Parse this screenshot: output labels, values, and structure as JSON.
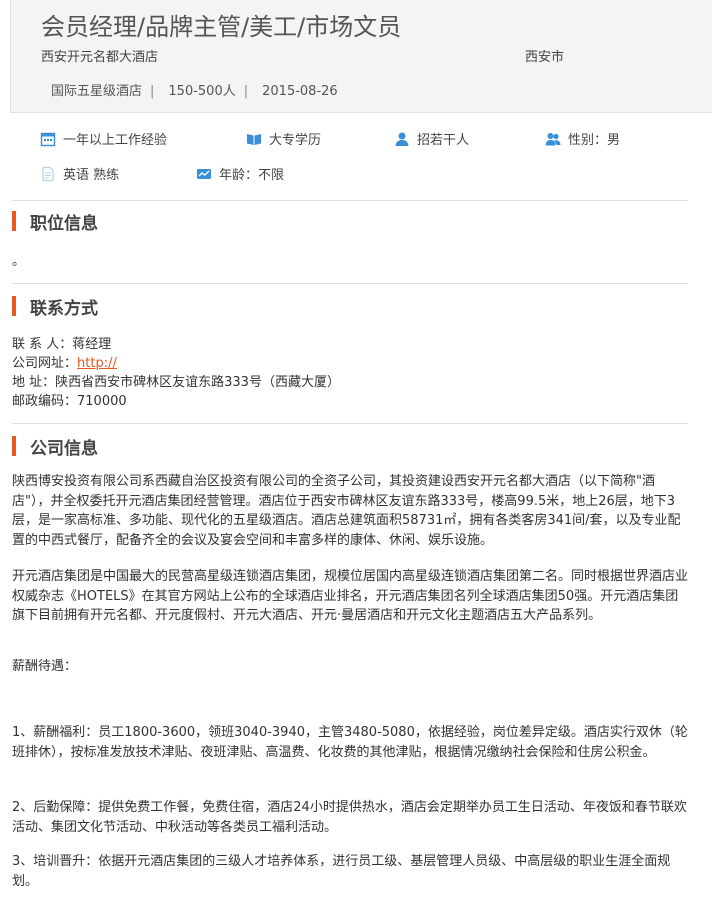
{
  "job": {
    "title": "会员经理/品牌主管/美工/市场文员",
    "company": "西安开元名都大酒店",
    "city": "西安市",
    "meta": [
      "国际五星级酒店",
      "150-500人",
      "2015-08-26"
    ],
    "meta_sep": "|"
  },
  "requirements": [
    {
      "icon": "calendar-icon",
      "label": "一年以上工作经验"
    },
    {
      "icon": "book-icon",
      "label": "大专学历"
    },
    {
      "icon": "person-icon",
      "label": "招若干人"
    },
    {
      "icon": "group-icon",
      "label": "性别：男"
    },
    {
      "icon": "document-icon",
      "label": "英语 熟练"
    },
    {
      "icon": "chart-icon",
      "label": "年龄：不限"
    }
  ],
  "sections": {
    "position": {
      "title": "职位信息",
      "body": "。"
    },
    "contact": {
      "title": "联系方式",
      "contact_person": "联 系 人：蒋经理",
      "website_label": "公司网址：",
      "website_link": "http://",
      "address": "地 址：陕西省西安市碑林区友谊东路333号（西藏大厦）",
      "postcode": "邮政编码：710000"
    },
    "company": {
      "title": "公司信息",
      "paragraphs": [
        "陕西博安投资有限公司系西藏自治区投资有限公司的全资子公司，其投资建设西安开元名都大酒店（以下简称\"酒店\"），并全权委托开元酒店集团经营管理。酒店位于西安市碑林区友谊东路333号，楼高99.5米，地上26层，地下3层，是一家高标准、多功能、现代化的五星级酒店。酒店总建筑面积58731㎡，拥有各类客房341间/套，以及专业配置的中西式餐厅，配备齐全的会议及宴会空间和丰富多样的康体、休闲、娱乐设施。",
        "开元酒店集团是中国最大的民营高星级连锁酒店集团，规模位居国内高星级连锁酒店集团第二名。同时根据世界酒店业权威杂志《HOTELS》在其官方网站上公布的全球酒店业排名，开元酒店集团名列全球酒店集团50强。开元酒店集团旗下目前拥有开元名都、开元度假村、开元大酒店、开元·曼居酒店和开元文化主题酒店五大产品系列。",
        "薪酬待遇：",
        "1、薪酬福利：员工1800-3600，领班3040-3940，主管3480-5080，依据经验，岗位差异定级。酒店实行双休（轮班排休），按标准发放技术津贴、夜班津贴、高温费、化妆费的其他津贴，根据情况缴纳社会保险和住房公积金。",
        "2、后勤保障：提供免费工作餐，免费住宿，酒店24小时提供热水，酒店会定期举办员工生日活动、年夜饭和春节联欢活动、集团文化节活动、中秋活动等各类员工福利活动。",
        "3、培训晋升：依据开元酒店集团的三级人才培养体系，进行员工级、基层管理人员级、中高层级的职业生涯全面规划。"
      ]
    }
  },
  "colors": {
    "accent": "#e8581d",
    "icon_blue": "#3b8fd9"
  }
}
